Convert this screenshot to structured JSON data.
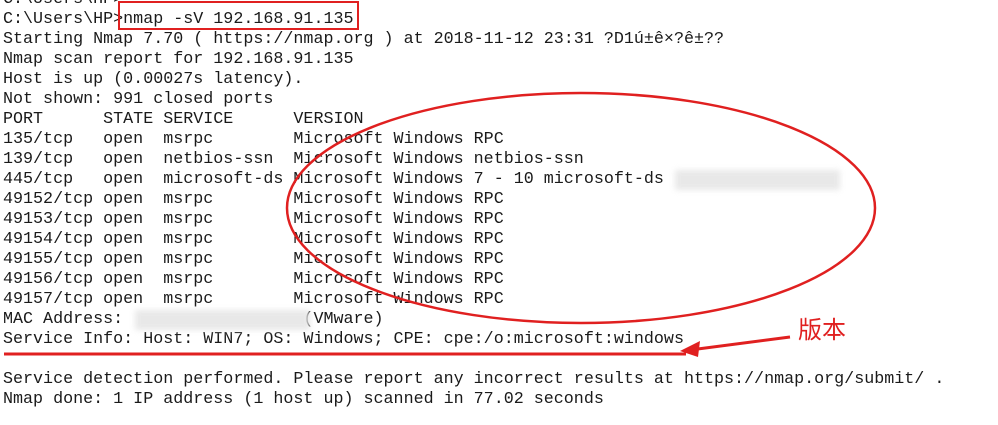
{
  "terminal": {
    "lines": [
      "C:\\Users\\HP>",
      "C:\\Users\\HP>nmap -sV 192.168.91.135",
      "Starting Nmap 7.70 ( https://nmap.org ) at 2018-11-12 23:31 ?D1ú±ê×?ê±??",
      "Nmap scan report for 192.168.91.135",
      "Host is up (0.00027s latency).",
      "Not shown: 991 closed ports",
      "PORT      STATE SERVICE      VERSION",
      "135/tcp   open  msrpc        Microsoft Windows RPC",
      "139/tcp   open  netbios-ssn  Microsoft Windows netbios-ssn",
      "445/tcp   open  microsoft-ds Microsoft Windows 7 - 10 microsoft-ds",
      "49152/tcp open  msrpc        Microsoft Windows RPC",
      "49153/tcp open  msrpc        Microsoft Windows RPC",
      "49154/tcp open  msrpc        Microsoft Windows RPC",
      "49155/tcp open  msrpc        Microsoft Windows RPC",
      "49156/tcp open  msrpc        Microsoft Windows RPC",
      "49157/tcp open  msrpc        Microsoft Windows RPC",
      "MAC Address:                  (VMware)",
      "Service Info: Host: WIN7; OS: Windows; CPE: cpe:/o:microsoft:windows",
      "",
      "Service detection performed. Please report any incorrect results at https://nmap.org/submit/ .",
      "Nmap done: 1 IP address (1 host up) scanned in 77.02 seconds"
    ]
  },
  "annotation": {
    "label": "版本",
    "color": "#e02020"
  }
}
